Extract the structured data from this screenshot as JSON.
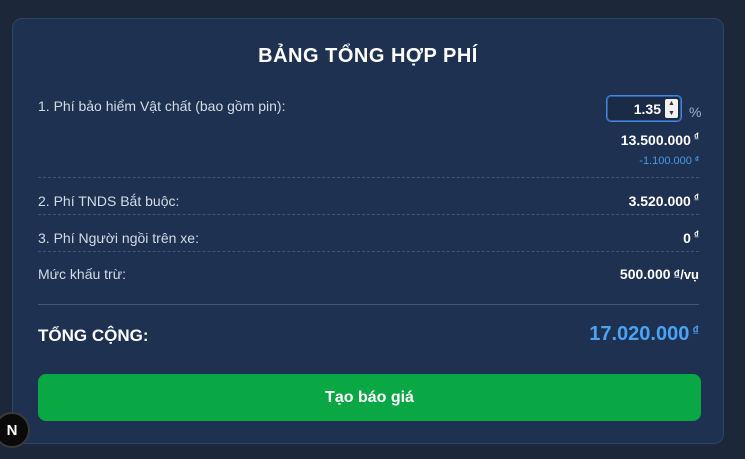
{
  "title": "BẢNG TỔNG HỢP PHÍ",
  "currency_symbol": "₫",
  "rows": {
    "physical": {
      "label": "1. Phí bảo hiểm Vật chất (bao gồm pin):",
      "rate_value": "1.35",
      "rate_unit": "%",
      "amount": "13.500.000",
      "discount": "-1.100.000"
    },
    "tnds": {
      "label": "2. Phí TNDS Bắt buộc:",
      "amount": "3.520.000"
    },
    "passenger": {
      "label": "3. Phí Người ngồi trên xe:",
      "amount": "0"
    },
    "deductible": {
      "label": "Mức khấu trừ:",
      "amount": "500.000",
      "unit": "₫/vụ"
    }
  },
  "total": {
    "label": "TỔNG CỘNG:",
    "amount": "17.020.000"
  },
  "cta_label": "Tạo báo giá",
  "badge_letter": "N",
  "colors": {
    "background": "#1c283a",
    "card": "#1e3150",
    "accent_blue": "#4aa3f5",
    "button_green": "#0aa745"
  }
}
